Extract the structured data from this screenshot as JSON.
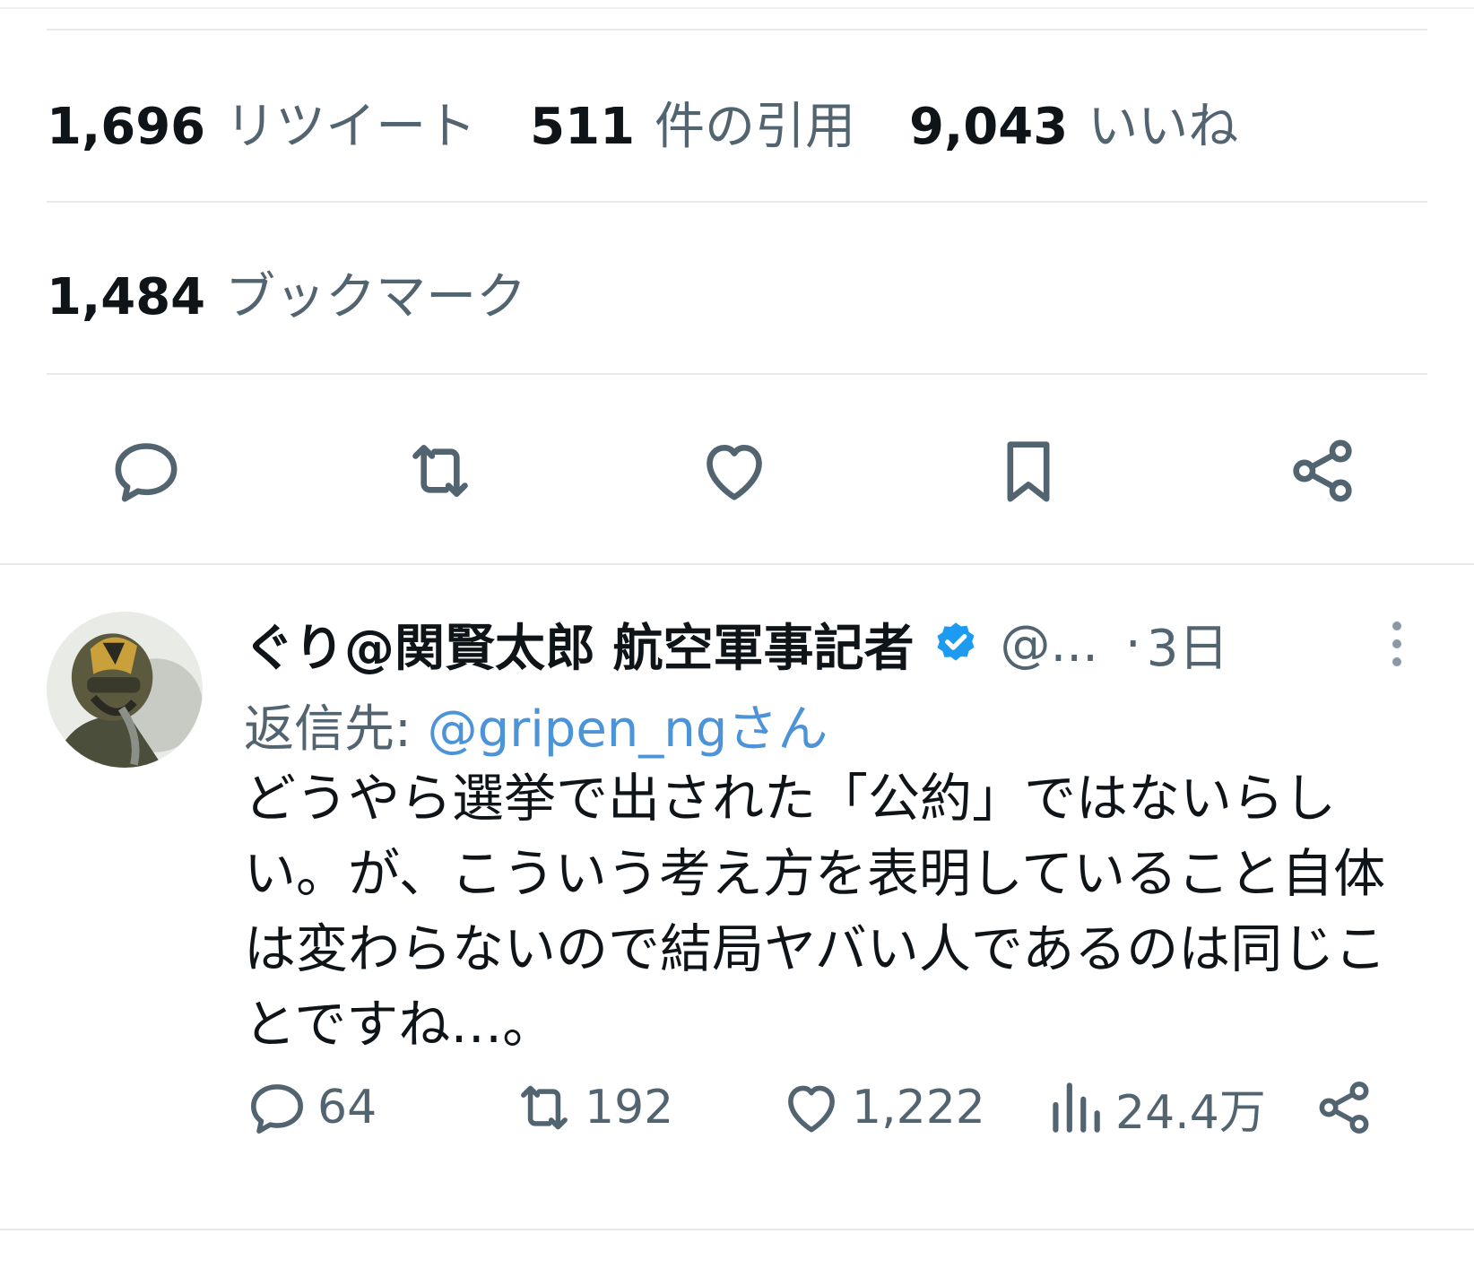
{
  "stats": {
    "retweets": {
      "count": "1,696",
      "label": "リツイート"
    },
    "quotes": {
      "count": "511",
      "label": "件の引用"
    },
    "likes": {
      "count": "9,043",
      "label": "いいね"
    },
    "bookmarks": {
      "count": "1,484",
      "label": "ブックマーク"
    }
  },
  "actions": [
    "reply-icon",
    "retweet-icon",
    "like-icon",
    "bookmark-icon",
    "share-icon"
  ],
  "reply": {
    "author_name": "ぐり@関賢太郎 航空軍事記者",
    "handle": "@...",
    "separator": "·",
    "time": "3日",
    "reply_to_label": "返信先: ",
    "reply_to_handle": "@gripen_ngさん",
    "text": "どうやら選挙で出された「公約」ではないらしい。が、こういう考え方を表明していること自体は変わらないので結局ヤバい人であるのは同じことですね…。",
    "metrics": {
      "replies": "64",
      "retweets": "192",
      "likes": "1,222",
      "views": "24.4万"
    }
  },
  "colors": {
    "text_primary": "#0f1419",
    "text_secondary": "#536471",
    "link": "#4d93d8",
    "verified": "#1d9bf0",
    "divider": "#e6e9eb"
  }
}
